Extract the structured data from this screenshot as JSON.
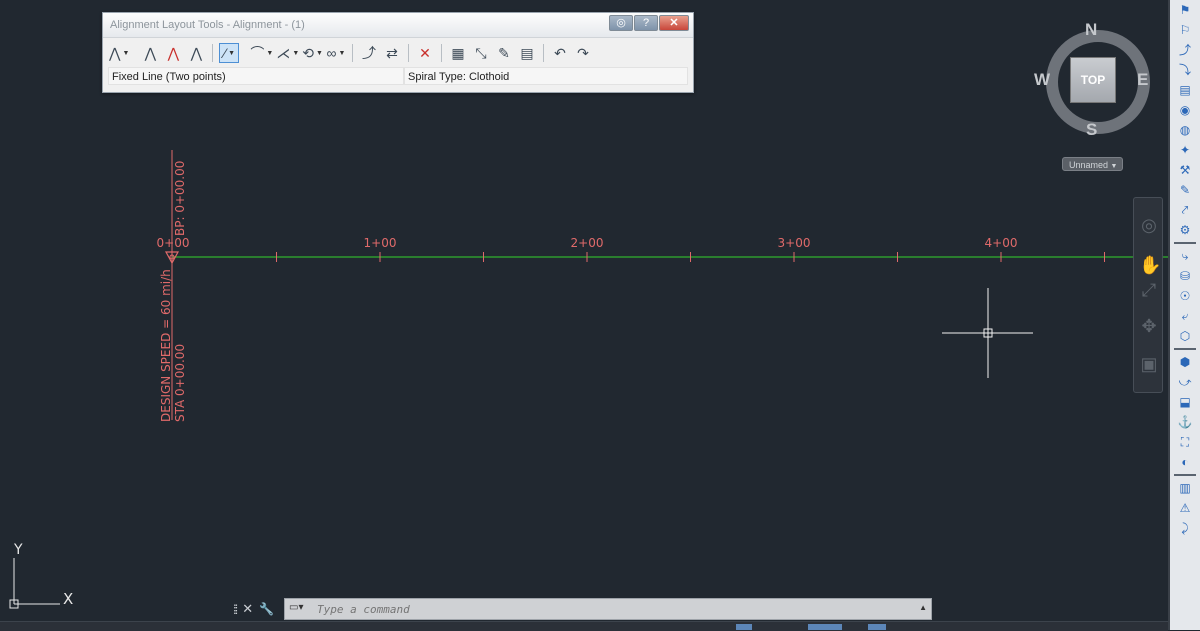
{
  "toolbar": {
    "title": "Alignment Layout Tools - Alignment - (1)",
    "buttons": {
      "close_label": "✕",
      "help_label": "?",
      "pin_label": "◎"
    },
    "status": {
      "left": "Fixed Line (Two points)",
      "right": "Spiral Type: Clothoid"
    }
  },
  "drawing": {
    "stations": [
      "0+00",
      "1+00",
      "2+00",
      "3+00",
      "4+00"
    ],
    "vertical_top": "BP: 0+00.00",
    "vertical_bottom_1": "DESIGN SPEED = 60 mi/h",
    "vertical_bottom_2": "STA 0+00.00",
    "colors": {
      "alignment": "#2e9a2e",
      "labels": "#e06a6a",
      "background": "#212830"
    }
  },
  "viewcube": {
    "face": "TOP",
    "north": "N",
    "south": "S",
    "east": "E",
    "west": "W",
    "wcs": "Unnamed"
  },
  "ucs": {
    "x_label": "X",
    "y_label": "Y"
  },
  "command": {
    "placeholder": "Type a command",
    "close_label": "✕",
    "settings_label": "🔧"
  }
}
